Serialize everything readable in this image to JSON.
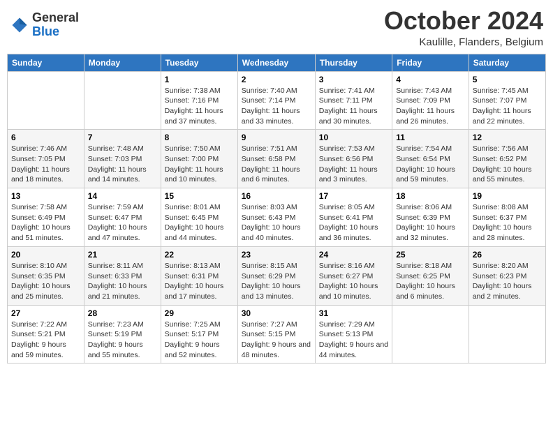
{
  "header": {
    "logo": {
      "line1": "General",
      "line2": "Blue"
    },
    "title": "October 2024",
    "location": "Kaulille, Flanders, Belgium"
  },
  "weekdays": [
    "Sunday",
    "Monday",
    "Tuesday",
    "Wednesday",
    "Thursday",
    "Friday",
    "Saturday"
  ],
  "weeks": [
    [
      {
        "day": "",
        "sunrise": "",
        "sunset": "",
        "daylight": ""
      },
      {
        "day": "",
        "sunrise": "",
        "sunset": "",
        "daylight": ""
      },
      {
        "day": "1",
        "sunrise": "Sunrise: 7:38 AM",
        "sunset": "Sunset: 7:16 PM",
        "daylight": "Daylight: 11 hours and 37 minutes."
      },
      {
        "day": "2",
        "sunrise": "Sunrise: 7:40 AM",
        "sunset": "Sunset: 7:14 PM",
        "daylight": "Daylight: 11 hours and 33 minutes."
      },
      {
        "day": "3",
        "sunrise": "Sunrise: 7:41 AM",
        "sunset": "Sunset: 7:11 PM",
        "daylight": "Daylight: 11 hours and 30 minutes."
      },
      {
        "day": "4",
        "sunrise": "Sunrise: 7:43 AM",
        "sunset": "Sunset: 7:09 PM",
        "daylight": "Daylight: 11 hours and 26 minutes."
      },
      {
        "day": "5",
        "sunrise": "Sunrise: 7:45 AM",
        "sunset": "Sunset: 7:07 PM",
        "daylight": "Daylight: 11 hours and 22 minutes."
      }
    ],
    [
      {
        "day": "6",
        "sunrise": "Sunrise: 7:46 AM",
        "sunset": "Sunset: 7:05 PM",
        "daylight": "Daylight: 11 hours and 18 minutes."
      },
      {
        "day": "7",
        "sunrise": "Sunrise: 7:48 AM",
        "sunset": "Sunset: 7:03 PM",
        "daylight": "Daylight: 11 hours and 14 minutes."
      },
      {
        "day": "8",
        "sunrise": "Sunrise: 7:50 AM",
        "sunset": "Sunset: 7:00 PM",
        "daylight": "Daylight: 11 hours and 10 minutes."
      },
      {
        "day": "9",
        "sunrise": "Sunrise: 7:51 AM",
        "sunset": "Sunset: 6:58 PM",
        "daylight": "Daylight: 11 hours and 6 minutes."
      },
      {
        "day": "10",
        "sunrise": "Sunrise: 7:53 AM",
        "sunset": "Sunset: 6:56 PM",
        "daylight": "Daylight: 11 hours and 3 minutes."
      },
      {
        "day": "11",
        "sunrise": "Sunrise: 7:54 AM",
        "sunset": "Sunset: 6:54 PM",
        "daylight": "Daylight: 10 hours and 59 minutes."
      },
      {
        "day": "12",
        "sunrise": "Sunrise: 7:56 AM",
        "sunset": "Sunset: 6:52 PM",
        "daylight": "Daylight: 10 hours and 55 minutes."
      }
    ],
    [
      {
        "day": "13",
        "sunrise": "Sunrise: 7:58 AM",
        "sunset": "Sunset: 6:49 PM",
        "daylight": "Daylight: 10 hours and 51 minutes."
      },
      {
        "day": "14",
        "sunrise": "Sunrise: 7:59 AM",
        "sunset": "Sunset: 6:47 PM",
        "daylight": "Daylight: 10 hours and 47 minutes."
      },
      {
        "day": "15",
        "sunrise": "Sunrise: 8:01 AM",
        "sunset": "Sunset: 6:45 PM",
        "daylight": "Daylight: 10 hours and 44 minutes."
      },
      {
        "day": "16",
        "sunrise": "Sunrise: 8:03 AM",
        "sunset": "Sunset: 6:43 PM",
        "daylight": "Daylight: 10 hours and 40 minutes."
      },
      {
        "day": "17",
        "sunrise": "Sunrise: 8:05 AM",
        "sunset": "Sunset: 6:41 PM",
        "daylight": "Daylight: 10 hours and 36 minutes."
      },
      {
        "day": "18",
        "sunrise": "Sunrise: 8:06 AM",
        "sunset": "Sunset: 6:39 PM",
        "daylight": "Daylight: 10 hours and 32 minutes."
      },
      {
        "day": "19",
        "sunrise": "Sunrise: 8:08 AM",
        "sunset": "Sunset: 6:37 PM",
        "daylight": "Daylight: 10 hours and 28 minutes."
      }
    ],
    [
      {
        "day": "20",
        "sunrise": "Sunrise: 8:10 AM",
        "sunset": "Sunset: 6:35 PM",
        "daylight": "Daylight: 10 hours and 25 minutes."
      },
      {
        "day": "21",
        "sunrise": "Sunrise: 8:11 AM",
        "sunset": "Sunset: 6:33 PM",
        "daylight": "Daylight: 10 hours and 21 minutes."
      },
      {
        "day": "22",
        "sunrise": "Sunrise: 8:13 AM",
        "sunset": "Sunset: 6:31 PM",
        "daylight": "Daylight: 10 hours and 17 minutes."
      },
      {
        "day": "23",
        "sunrise": "Sunrise: 8:15 AM",
        "sunset": "Sunset: 6:29 PM",
        "daylight": "Daylight: 10 hours and 13 minutes."
      },
      {
        "day": "24",
        "sunrise": "Sunrise: 8:16 AM",
        "sunset": "Sunset: 6:27 PM",
        "daylight": "Daylight: 10 hours and 10 minutes."
      },
      {
        "day": "25",
        "sunrise": "Sunrise: 8:18 AM",
        "sunset": "Sunset: 6:25 PM",
        "daylight": "Daylight: 10 hours and 6 minutes."
      },
      {
        "day": "26",
        "sunrise": "Sunrise: 8:20 AM",
        "sunset": "Sunset: 6:23 PM",
        "daylight": "Daylight: 10 hours and 2 minutes."
      }
    ],
    [
      {
        "day": "27",
        "sunrise": "Sunrise: 7:22 AM",
        "sunset": "Sunset: 5:21 PM",
        "daylight": "Daylight: 9 hours and 59 minutes."
      },
      {
        "day": "28",
        "sunrise": "Sunrise: 7:23 AM",
        "sunset": "Sunset: 5:19 PM",
        "daylight": "Daylight: 9 hours and 55 minutes."
      },
      {
        "day": "29",
        "sunrise": "Sunrise: 7:25 AM",
        "sunset": "Sunset: 5:17 PM",
        "daylight": "Daylight: 9 hours and 52 minutes."
      },
      {
        "day": "30",
        "sunrise": "Sunrise: 7:27 AM",
        "sunset": "Sunset: 5:15 PM",
        "daylight": "Daylight: 9 hours and 48 minutes."
      },
      {
        "day": "31",
        "sunrise": "Sunrise: 7:29 AM",
        "sunset": "Sunset: 5:13 PM",
        "daylight": "Daylight: 9 hours and 44 minutes."
      },
      {
        "day": "",
        "sunrise": "",
        "sunset": "",
        "daylight": ""
      },
      {
        "day": "",
        "sunrise": "",
        "sunset": "",
        "daylight": ""
      }
    ]
  ]
}
